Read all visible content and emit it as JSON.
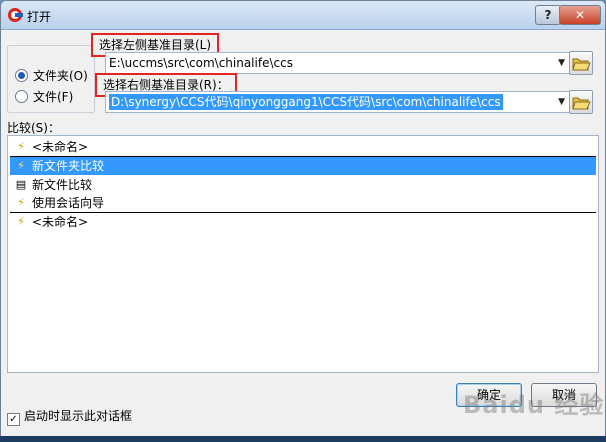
{
  "window": {
    "title": "打开"
  },
  "titlebar": {
    "help_label": "?",
    "close_label": "✕"
  },
  "source": {
    "folder_label": "文件夹(O)",
    "file_label": "文件(F)",
    "selected": "folder"
  },
  "left": {
    "label": "选择左侧基准目录(L)",
    "value": "E:\\uccms\\src\\com\\chinalife\\ccs"
  },
  "right": {
    "label": "选择右侧基准目录(R)：",
    "value": "D:\\synergy\\CCS代码\\qinyonggang1\\CCS代码\\src\\com\\chinalife\\ccs"
  },
  "compare": {
    "label": "比较(S)：",
    "items": [
      {
        "label": "<未命名>",
        "icon": "lightning-icon"
      },
      {
        "label": "新文件夹比较",
        "icon": "lightning-icon",
        "selected": true
      },
      {
        "label": "新文件比较",
        "icon": "document-compare-icon"
      },
      {
        "label": "使用会话向导",
        "icon": "wizard-icon"
      },
      {
        "label": "<未命名>",
        "icon": "lightning-icon"
      }
    ]
  },
  "buttons": {
    "ok": "确定",
    "cancel": "取消"
  },
  "options": {
    "show_on_startup": "启动时显示此对话框",
    "checked": true
  },
  "watermark": "Baidu 经验",
  "colors": {
    "selection": "#3399ff",
    "highlight_box": "#e0261f"
  }
}
